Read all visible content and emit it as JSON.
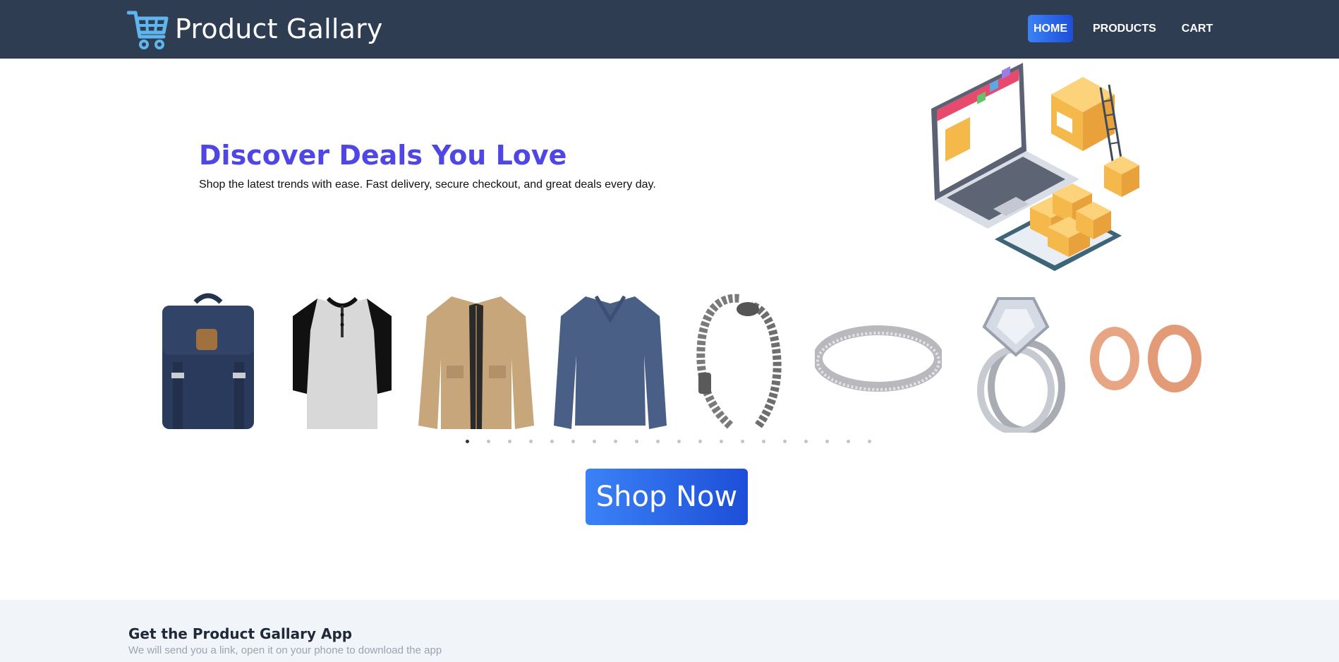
{
  "header": {
    "logo_icon": "shopping-cart-icon",
    "title": "Product Gallary",
    "nav": [
      {
        "label": "HOME",
        "active": true
      },
      {
        "label": "PRODUCTS",
        "active": false
      },
      {
        "label": "CART",
        "active": false
      }
    ]
  },
  "hero": {
    "title": "Discover Deals You Love",
    "subtitle": "Shop the latest trends with ease. Fast delivery, secure checkout, and great deals every day.",
    "illustration": "laptop-ecommerce-illustration"
  },
  "carousel": {
    "items": [
      "backpack",
      "henley-shirt",
      "jacket",
      "long-sleeve-shirt",
      "dragon-bracelet",
      "silver-ring",
      "diamond-ring-set",
      "rose-gold-tunnels"
    ],
    "dot_count": 20,
    "active_index": 0
  },
  "cta": {
    "label": "Shop Now"
  },
  "app": {
    "title": "Get the Product Gallary App",
    "subtitle": "We will send you a link, open it on your phone to download the app"
  },
  "colors": {
    "navbar": "#2e3d52",
    "accent_start": "#3b82f6",
    "accent_end": "#1d4ed8",
    "hero_title": "#4f46e5",
    "app_bg": "#f1f4f8"
  }
}
